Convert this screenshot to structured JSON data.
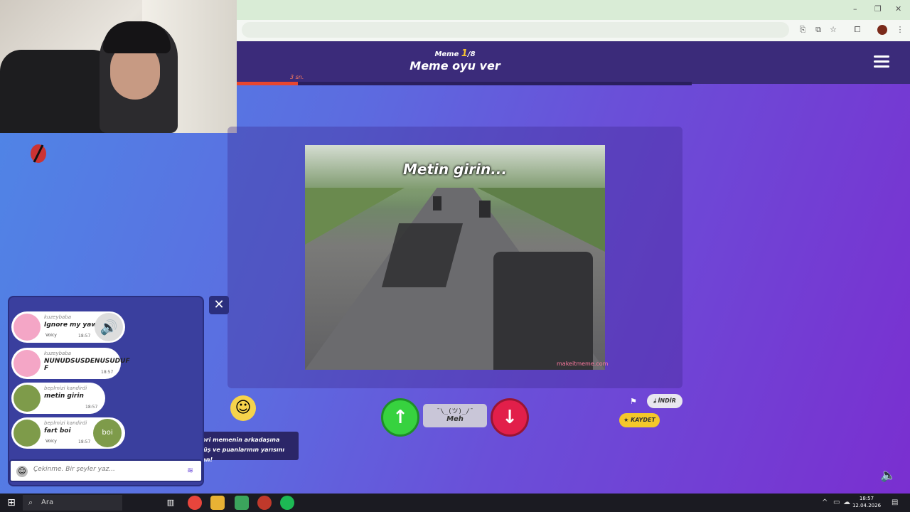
{
  "window": {
    "minimize": "–",
    "restore": "❐",
    "close": "✕"
  },
  "toolbar": {
    "translate_icon": "translate-icon",
    "cast_icon": "cast-icon",
    "star_icon": "star-icon",
    "extensions_icon": "puzzle-icon",
    "more_icon": "more-vert-icon"
  },
  "game": {
    "header_sub_prefix": "Meme ",
    "header_sub_num": "1",
    "header_sub_suffix": "/8",
    "title": "Meme oyu ver",
    "timer_label": "3 sn.",
    "timer_progress": 0.135,
    "meme_caption": "Metin girin...",
    "watermark": "makeitmeme.com",
    "meh_face": "¯\\_(ツ)_/¯",
    "meh_label": "Meh",
    "download_label": "İNDİR",
    "save_label": "KAYDET",
    "tooltip": "Favori memenin arkadaşına dönüş ve puanlarının yarısını kazan!"
  },
  "chat": {
    "messages": [
      {
        "user": "kuzeybaba",
        "text": "Ignore my yawn",
        "voicy": "Voicy",
        "time": "18:57"
      },
      {
        "user": "kuzeybaba",
        "text": "NUNUDSUSDENUSUDUF F",
        "time": "18:57"
      },
      {
        "user": "beplmizi kandirdi",
        "text": "metin girin",
        "time": "18:57"
      },
      {
        "user": "beplmizi kandirdi",
        "text": "fart boi",
        "voicy": "Voicy",
        "time": "18:57",
        "thumb_text": "boi"
      }
    ],
    "input_placeholder": "Çekinme. Bir şeyler yaz..."
  },
  "taskbar": {
    "search_placeholder": "Ara",
    "time": "18:57",
    "date": "12.04.2026"
  },
  "colors": {
    "upvote": "#37d23f",
    "downvote": "#e21f4a",
    "accent": "#f6c431"
  }
}
